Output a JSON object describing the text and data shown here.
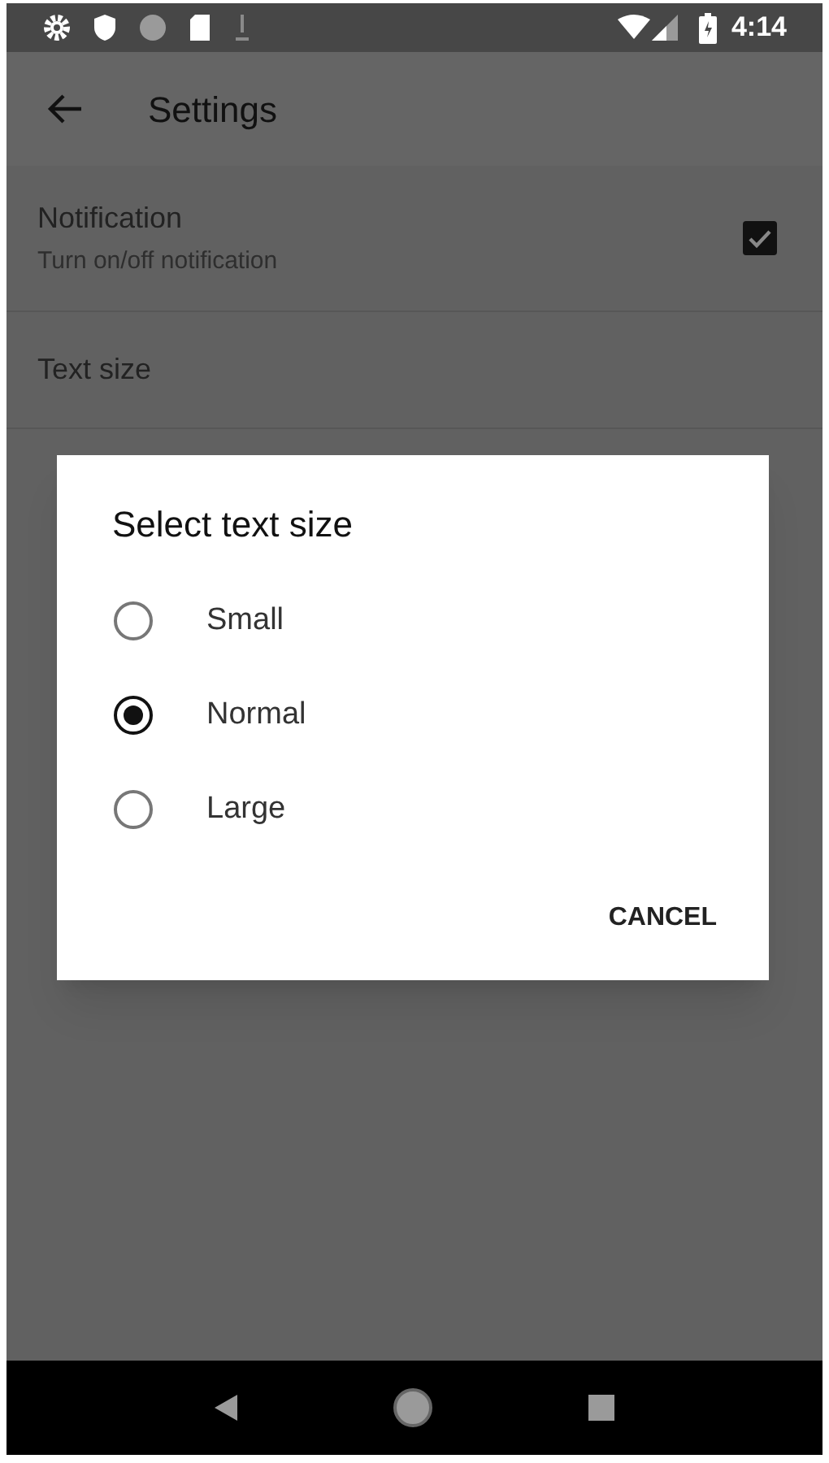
{
  "status_bar": {
    "time": "4:14"
  },
  "app_bar": {
    "title": "Settings"
  },
  "preferences": [
    {
      "kind": "checkbox",
      "title": "Notification",
      "summary": "Turn on/off notification",
      "checked": true
    },
    {
      "kind": "plain",
      "title": "Text size"
    }
  ],
  "dialog": {
    "title": "Select text size",
    "options": [
      {
        "label": "Small",
        "selected": false
      },
      {
        "label": "Normal",
        "selected": true
      },
      {
        "label": "Large",
        "selected": false
      }
    ],
    "buttons": [
      "CANCEL"
    ]
  }
}
